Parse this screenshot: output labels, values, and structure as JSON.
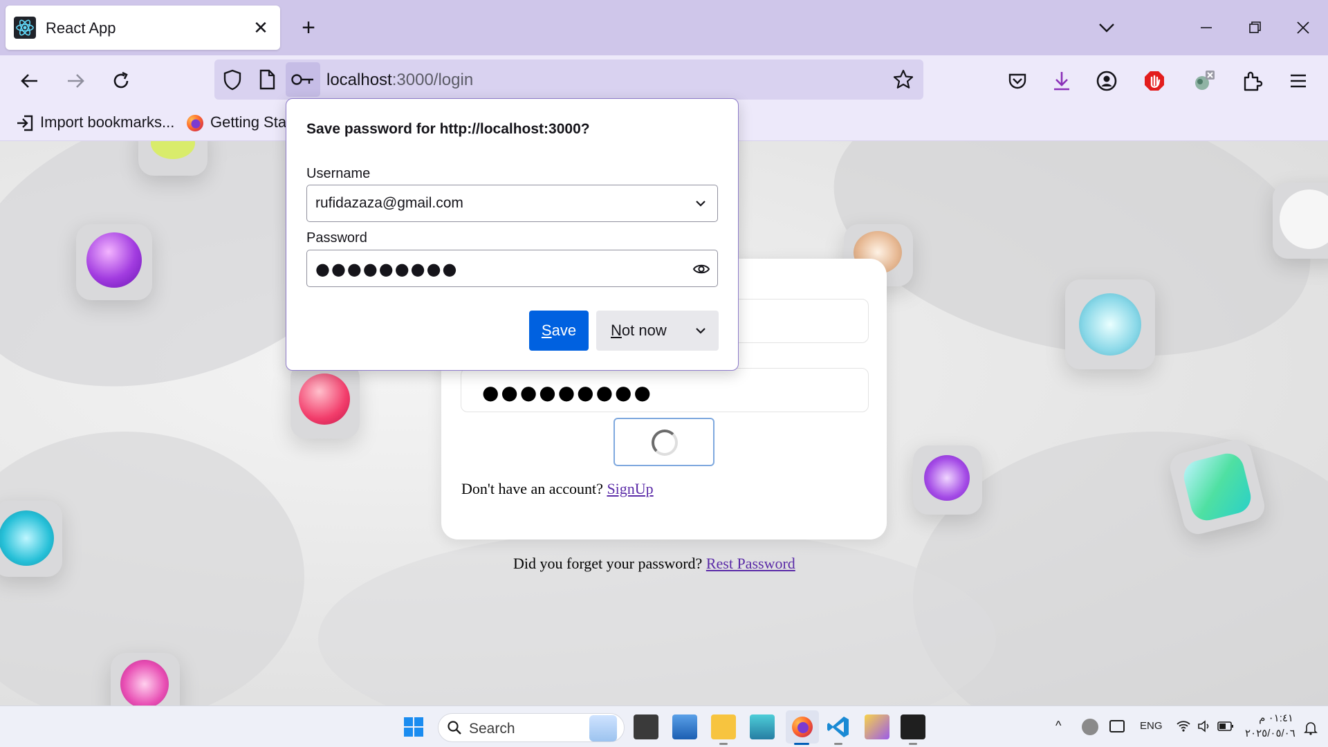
{
  "browser": {
    "tab_title": "React App",
    "url_host": "localhost",
    "url_rest": ":3000/login"
  },
  "bookmarks": {
    "import": "Import bookmarks...",
    "getting_started": "Getting Star"
  },
  "password_popup": {
    "title": "Save password for http://localhost:3000?",
    "username_label": "Username",
    "username_value": "rufidazaza@gmail.com",
    "password_label": "Password",
    "password_value": "●●●●●●●●●",
    "save_label_u": "S",
    "save_label_rest": "ave",
    "notnow_label_u": "N",
    "notnow_label_rest": "ot now"
  },
  "login": {
    "password_dots": "●●●●●●●●●",
    "signup_prompt": "Don't have an account?",
    "signup_link": "SignUp",
    "forgot_prompt": "Did you forget your password?",
    "forgot_link": "Rest Password"
  },
  "taskbar": {
    "search_label": "Search",
    "language": "ENG",
    "time": "٠١:٤١ م",
    "date": "٢٠٢٥/٠٥/٠٦"
  },
  "colors": {
    "accent": "#0061e0",
    "link": "#5a2aa7",
    "tabstrip": "#cfc6ea"
  }
}
